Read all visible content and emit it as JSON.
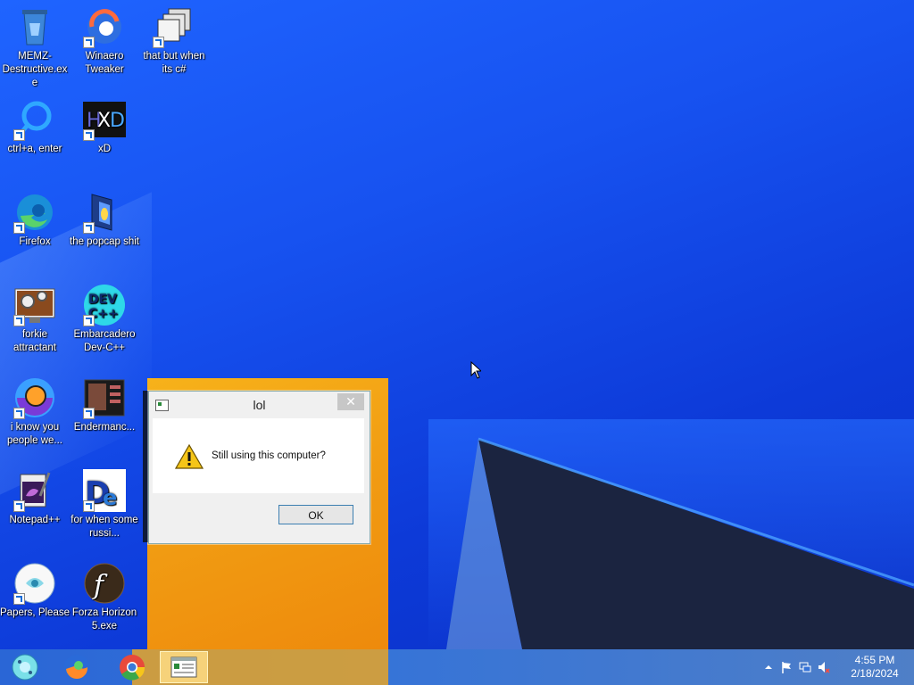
{
  "desktop": {
    "icons": [
      {
        "label": "MEMZ-Destructive.exe",
        "icon": "recycle-bin-icon"
      },
      {
        "label": "Winaero Tweaker",
        "icon": "winaero-icon"
      },
      {
        "label": "that but when its c#",
        "icon": "stacked-windows-icon"
      },
      {
        "label": "ctrl+a, enter",
        "icon": "search-ring-icon"
      },
      {
        "label": "xD",
        "icon": "hxd-icon"
      },
      {
        "label": "Firefox",
        "icon": "edge-icon"
      },
      {
        "label": "the popcap shit",
        "icon": "folder-icon"
      },
      {
        "label": "forkie attractant",
        "icon": "settings-monitor-icon"
      },
      {
        "label": "Embarcadero Dev-C++",
        "icon": "devcpp-icon"
      },
      {
        "label": "i know you people we...",
        "icon": "firefox-like-icon"
      },
      {
        "label": "Endermanc...",
        "icon": "enderman-icon"
      },
      {
        "label": "Notepad++",
        "icon": "notepadpp-icon"
      },
      {
        "label": "for when some russi...",
        "icon": "de-icon"
      },
      {
        "label": "Papers, Please",
        "icon": "papers-please-icon"
      },
      {
        "label": "Forza Horizon 5.exe",
        "icon": "flash-icon"
      }
    ]
  },
  "dialog": {
    "title": "lol",
    "close_glyph": "✕",
    "message": "Still using this computer?",
    "ok_label": "OK"
  },
  "taskbar": {
    "pinned": [
      "snowflake-orb-icon",
      "firefox-icon",
      "chrome-icon"
    ],
    "active_app": "dialog-window-icon",
    "tray_icons": [
      "show-hidden-icons-chevron",
      "action-center-flag-icon",
      "network-icon",
      "volume-muted-icon"
    ],
    "time": "4:55 PM",
    "date": "2/18/2024"
  },
  "colors": {
    "desktop": "#1752f0",
    "tile": "#f19b12",
    "taskbar": "#3573d8"
  }
}
